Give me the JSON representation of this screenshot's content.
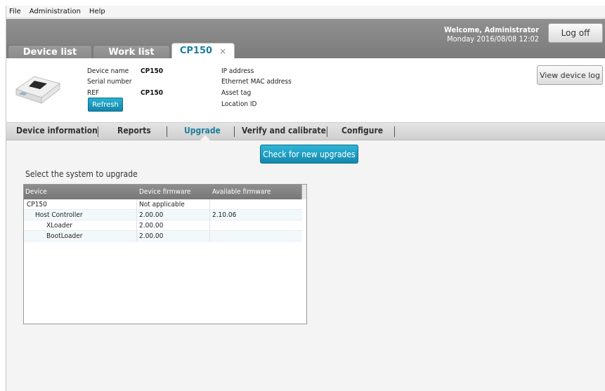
{
  "menu": [
    "File",
    "Administration",
    "Help"
  ],
  "header": {
    "welcome_line1": "Welcome,  Administrator",
    "welcome_line2": "Monday  2016/08/08 12:02",
    "logoff_label": "Log off"
  },
  "tabs": [
    {
      "label": "Device list"
    },
    {
      "label": "Work list"
    },
    {
      "label": "CP150",
      "close": "×"
    }
  ],
  "device": {
    "labels_left": [
      "Device name",
      "Serial number",
      "REF"
    ],
    "values_left": [
      "CP150",
      "",
      "CP150"
    ],
    "labels_right": [
      "IP address",
      "Ethernet MAC address",
      "Asset tag",
      "Location ID"
    ],
    "refresh_label": "Refresh",
    "view_log_label": "View device log"
  },
  "subtabs": [
    "Device information",
    "Reports",
    "Upgrade",
    "Verify and calibrate",
    "Configure"
  ],
  "upgrade": {
    "check_label": "Check for new upgrades",
    "select_label": "Select the system to upgrade",
    "columns": [
      "Device",
      "Device firmware",
      "Available firmware"
    ],
    "rows": [
      {
        "device": "CP150",
        "firmware": "Not applicable",
        "available": ""
      },
      {
        "device": "Host Controller",
        "firmware": "2.00.00",
        "available": "2.10.06"
      },
      {
        "device": "XLoader",
        "firmware": "2.00.00",
        "available": ""
      },
      {
        "device": "BootLoader",
        "firmware": "2.00.00",
        "available": ""
      }
    ]
  },
  "colors": {
    "accent": "#1c7f9f",
    "button": "#1a95bb",
    "header": "#848484"
  }
}
